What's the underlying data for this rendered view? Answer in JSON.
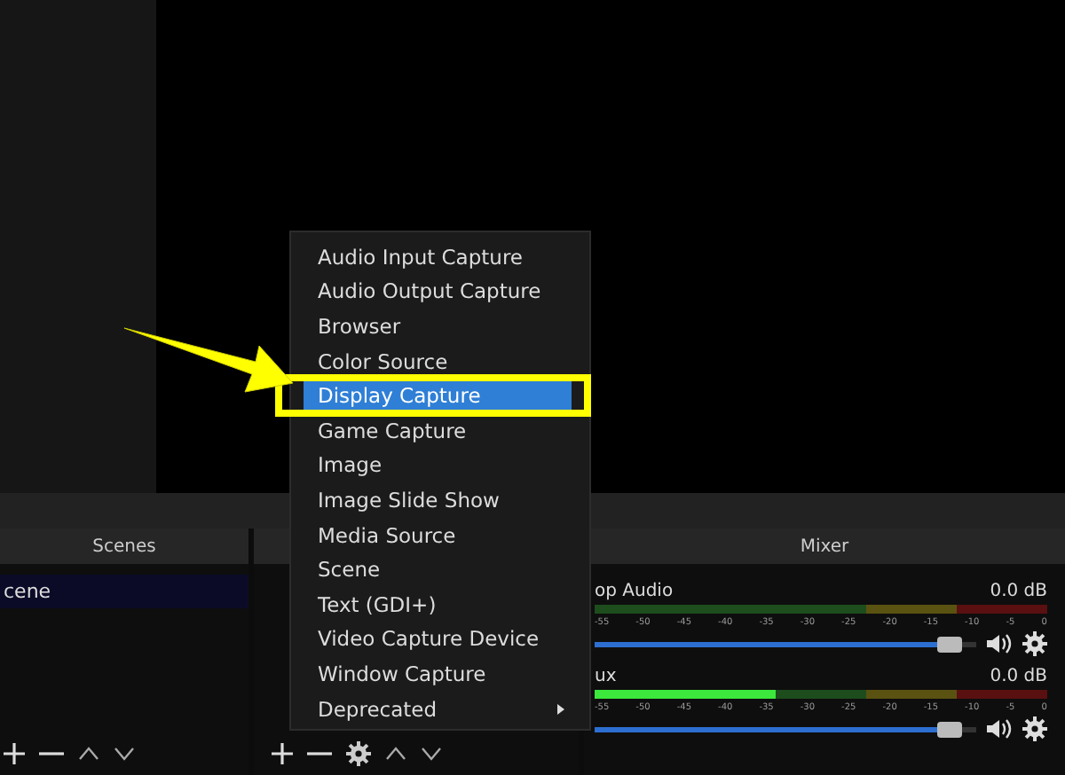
{
  "scenes": {
    "title": "Scenes",
    "items": [
      {
        "label": "cene",
        "selected": true
      }
    ]
  },
  "context_menu": {
    "items": [
      {
        "label": "Audio Input Capture",
        "selected": false,
        "has_submenu": false
      },
      {
        "label": "Audio Output Capture",
        "selected": false,
        "has_submenu": false
      },
      {
        "label": "Browser",
        "selected": false,
        "has_submenu": false
      },
      {
        "label": "Color Source",
        "selected": false,
        "has_submenu": false
      },
      {
        "label": "Display Capture",
        "selected": true,
        "has_submenu": false
      },
      {
        "label": "Game Capture",
        "selected": false,
        "has_submenu": false
      },
      {
        "label": "Image",
        "selected": false,
        "has_submenu": false
      },
      {
        "label": "Image Slide Show",
        "selected": false,
        "has_submenu": false
      },
      {
        "label": "Media Source",
        "selected": false,
        "has_submenu": false
      },
      {
        "label": "Scene",
        "selected": false,
        "has_submenu": false
      },
      {
        "label": "Text (GDI+)",
        "selected": false,
        "has_submenu": false
      },
      {
        "label": "Video Capture Device",
        "selected": false,
        "has_submenu": false
      },
      {
        "label": "Window Capture",
        "selected": false,
        "has_submenu": false
      },
      {
        "label": "Deprecated",
        "selected": false,
        "has_submenu": true
      }
    ]
  },
  "mixer": {
    "title": "Mixer",
    "channels": [
      {
        "name": "op Audio",
        "reading": "0.0 dB",
        "scale": [
          "-55",
          "-50",
          "-45",
          "-40",
          "-35",
          "-30",
          "-25",
          "-20",
          "-15",
          "-10",
          "-5",
          "0"
        ],
        "volume": {
          "level": 0.93
        }
      },
      {
        "name": "ux",
        "reading": "0.0 dB",
        "meter": {
          "level": 0.4
        },
        "scale": [
          "-55",
          "-50",
          "-45",
          "-40",
          "-35",
          "-30",
          "-25",
          "-20",
          "-15",
          "-10",
          "-5",
          "0"
        ],
        "volume": {
          "level": 0.93
        }
      }
    ]
  }
}
